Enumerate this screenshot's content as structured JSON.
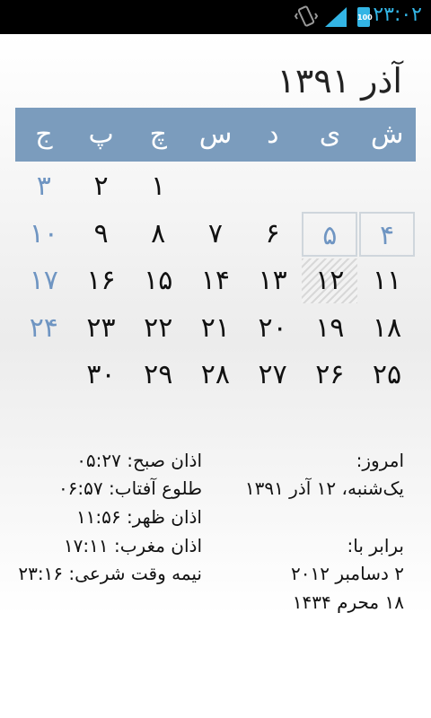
{
  "status_bar": {
    "time": "۲۳:۰۲",
    "battery": "100",
    "icons": [
      "vibrate-icon",
      "signal-icon",
      "battery-icon"
    ],
    "accent_color": "#33b5e5"
  },
  "calendar": {
    "title": "آذر ۱۳۹۱",
    "weekdays": [
      "ش",
      "ی",
      "د",
      "س",
      "چ",
      "پ",
      "ج"
    ],
    "header_color": "#7b9cbd",
    "friday_color": "#6f95c2",
    "weeks": [
      [
        "",
        "",
        "",
        "",
        "۱",
        "۲",
        "۳"
      ],
      [
        "۴",
        "۵",
        "۶",
        "۷",
        "۸",
        "۹",
        "۱۰"
      ],
      [
        "۱۱",
        "۱۲",
        "۱۳",
        "۱۴",
        "۱۵",
        "۱۶",
        "۱۷"
      ],
      [
        "۱۸",
        "۱۹",
        "۲۰",
        "۲۱",
        "۲۲",
        "۲۳",
        "۲۴"
      ],
      [
        "۲۵",
        "۲۶",
        "۲۷",
        "۲۸",
        "۲۹",
        "۳۰",
        ""
      ]
    ]
  },
  "today": {
    "label": "امروز:",
    "date": "یک‌شنبه، ۱۲ آذر ۱۳۹۱",
    "equivalent_label": "برابر با:",
    "gregorian": "۲ دسامبر ۲۰۱۲",
    "hijri": "۱۸ محرم ۱۴۳۴"
  },
  "prayer_times": [
    "اذان صبح: ۰۵:۲۷",
    "طلوع آفتاب: ۰۶:۵۷",
    "اذان ظهر: ۱۱:۵۶",
    "اذان مغرب: ۱۷:۱۱",
    "نیمه وقت شرعی: ۲۳:۱۶"
  ]
}
